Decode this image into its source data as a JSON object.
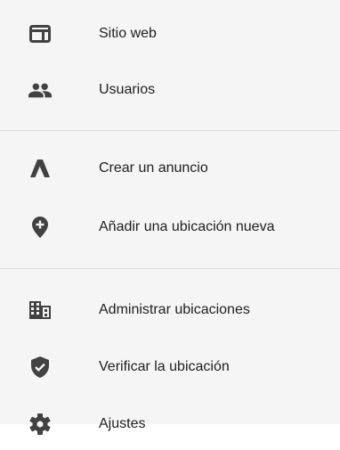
{
  "menu": {
    "items": [
      {
        "label": "Sitio web",
        "icon": "web-icon"
      },
      {
        "label": "Usuarios",
        "icon": "people-icon"
      },
      {
        "label": "Crear un anuncio",
        "icon": "google-ads-icon"
      },
      {
        "label": "Añadir una ubicación nueva",
        "icon": "add-location-icon"
      },
      {
        "label": "Administrar ubicaciones",
        "icon": "business-icon"
      },
      {
        "label": "Verificar la ubicación",
        "icon": "verified-shield-icon"
      },
      {
        "label": "Ajustes",
        "icon": "gear-icon"
      }
    ],
    "colors": {
      "background": "#f5f5f5",
      "icon": "#424242",
      "text": "#212121",
      "divider": "#dcdcdc"
    }
  }
}
